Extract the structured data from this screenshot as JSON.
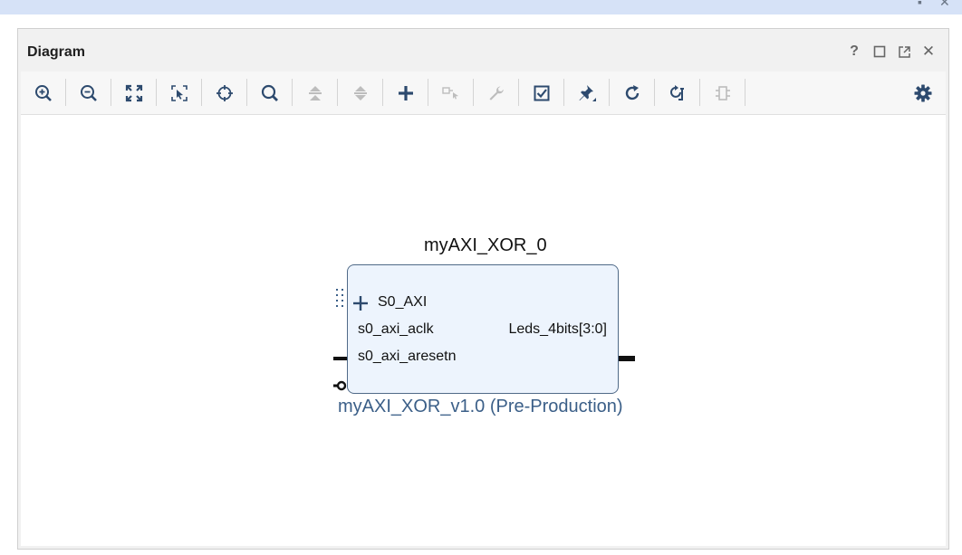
{
  "window": {
    "title_controls": [
      "minimize-icon",
      "close-icon"
    ]
  },
  "panel": {
    "title": "Diagram",
    "header_buttons": [
      {
        "name": "help",
        "glyph": "?"
      },
      {
        "name": "maximize",
        "icon": "square-icon"
      },
      {
        "name": "float",
        "icon": "float-window-icon"
      },
      {
        "name": "close",
        "glyph": "✕"
      }
    ]
  },
  "toolbar": {
    "buttons": [
      {
        "name": "zoom-in",
        "icon": "zoom-in-icon",
        "enabled": true
      },
      {
        "name": "zoom-out",
        "icon": "zoom-out-icon",
        "enabled": true
      },
      {
        "name": "zoom-fit",
        "icon": "fit-icon",
        "enabled": true
      },
      {
        "name": "zoom-area",
        "icon": "zoom-area-icon",
        "enabled": true
      },
      {
        "name": "center",
        "icon": "crosshair-icon",
        "enabled": true
      },
      {
        "name": "search",
        "icon": "search-icon",
        "enabled": true
      },
      {
        "name": "collapse-all",
        "icon": "collapse-icon",
        "enabled": false
      },
      {
        "name": "expand-all",
        "icon": "expand-icon",
        "enabled": false
      },
      {
        "name": "add-ip",
        "icon": "plus-icon",
        "enabled": true
      },
      {
        "name": "make-connection",
        "icon": "connection-icon",
        "enabled": false
      },
      {
        "name": "properties",
        "icon": "wrench-icon",
        "enabled": false
      },
      {
        "name": "validate",
        "icon": "checkbox-icon",
        "enabled": true
      },
      {
        "name": "pin",
        "icon": "pin-icon",
        "enabled": true
      },
      {
        "name": "regenerate-layout",
        "icon": "refresh-icon",
        "enabled": true
      },
      {
        "name": "optimize-routing",
        "icon": "routing-icon",
        "enabled": true
      },
      {
        "name": "debug",
        "icon": "chip-icon",
        "enabled": false
      }
    ],
    "settings_icon": "gear-icon"
  },
  "diagram": {
    "block": {
      "instance_name": "myAXI_XOR_0",
      "ip_name": "myAXI_XOR_v1.0 (Pre-Production)",
      "input_ports": [
        {
          "label": "S0_AXI",
          "type": "interface"
        },
        {
          "label": "s0_axi_aclk",
          "type": "clock"
        },
        {
          "label": "s0_axi_aresetn",
          "type": "reset-active-low"
        }
      ],
      "output_ports": [
        {
          "label": "Leds_4bits[3:0]",
          "type": "bus"
        }
      ]
    }
  },
  "colors": {
    "accent": "#2d4a6e",
    "block_fill": "#edf4fd",
    "block_border": "#506a88",
    "subtitle": "#3b5f88",
    "top_strip": "#d6e2f7"
  }
}
